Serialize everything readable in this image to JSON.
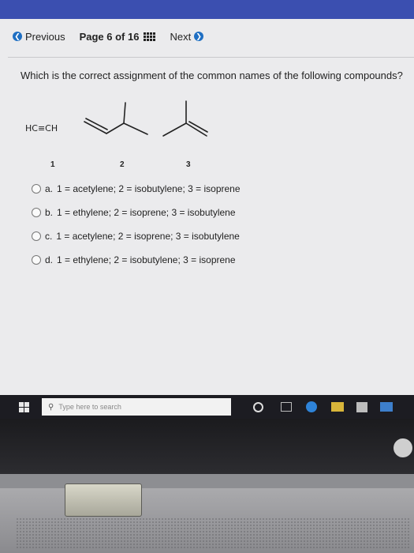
{
  "nav": {
    "previous_label": "Previous",
    "page_indicator": "Page 6 of 16",
    "next_label": "Next",
    "previous_icon": "chevron-left-circle-icon",
    "next_icon": "chevron-right-circle-icon",
    "accent": "#1f6fc3"
  },
  "question": {
    "text": "Which is the correct assignment of the common names of the following compounds?",
    "compound_1_formula": "HC≡CH",
    "compound_labels": [
      "1",
      "2",
      "3"
    ]
  },
  "options": [
    {
      "letter": "a.",
      "text": "1 = acetylene; 2 = isobutylene; 3 = isoprene"
    },
    {
      "letter": "b.",
      "text": "1 = ethylene; 2 = isoprene; 3 = isobutylene"
    },
    {
      "letter": "c.",
      "text": "1 = acetylene; 2 = isoprene; 3 = isobutylene"
    },
    {
      "letter": "d.",
      "text": "1 = ethylene; 2 = isobutylene; 3 = isoprene"
    }
  ],
  "taskbar": {
    "search_placeholder": "Type here to search",
    "icons": [
      "windows-start-icon",
      "search-icon",
      "cortana-icon",
      "task-view-icon",
      "edge-icon",
      "file-explorer-icon",
      "store-icon",
      "mail-icon"
    ],
    "background": "#1c1c22"
  }
}
